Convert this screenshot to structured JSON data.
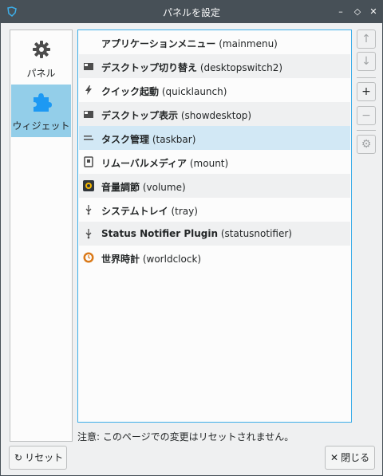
{
  "window": {
    "title": "パネルを設定",
    "minimize_glyph": "–",
    "maximize_glyph": "◇",
    "close_glyph": "✕"
  },
  "sidebar": {
    "items": [
      {
        "label": "パネル",
        "icon": "gear-icon",
        "selected": false
      },
      {
        "label": "ウィジェット",
        "icon": "puzzle-icon",
        "selected": true
      }
    ]
  },
  "widgets": {
    "items": [
      {
        "name": "アプリケーションメニュー",
        "id": "(mainmenu)",
        "icon": "none"
      },
      {
        "name": "デスクトップ切り替え",
        "id": "(desktopswitch2)",
        "icon": "desktop-icon"
      },
      {
        "name": "クイック起動",
        "id": "(quicklaunch)",
        "icon": "lightning-icon"
      },
      {
        "name": "デスクトップ表示",
        "id": "(showdesktop)",
        "icon": "desktop-icon"
      },
      {
        "name": "タスク管理",
        "id": "(taskbar)",
        "icon": "taskbar-icon"
      },
      {
        "name": "リムーバルメディア",
        "id": "(mount)",
        "icon": "drive-icon"
      },
      {
        "name": "音量調節",
        "id": "(volume)",
        "icon": "speaker-icon"
      },
      {
        "name": "システムトレイ",
        "id": "(tray)",
        "icon": "tray-icon"
      },
      {
        "name": "Status Notifier Plugin",
        "id": "(statusnotifier)",
        "icon": "tray-icon"
      },
      {
        "name": "世界時計",
        "id": "(worldclock)",
        "icon": "clock-icon"
      }
    ]
  },
  "buttons": {
    "move_up": "↑",
    "move_down": "↓",
    "add": "+",
    "remove": "−",
    "configure": "⚙"
  },
  "footer": {
    "note": "注意: このページでの変更はリセットされません。",
    "reset_label": "リセット",
    "reset_icon_glyph": "↻",
    "close_label": "閉じる",
    "close_icon_glyph": "✕"
  }
}
